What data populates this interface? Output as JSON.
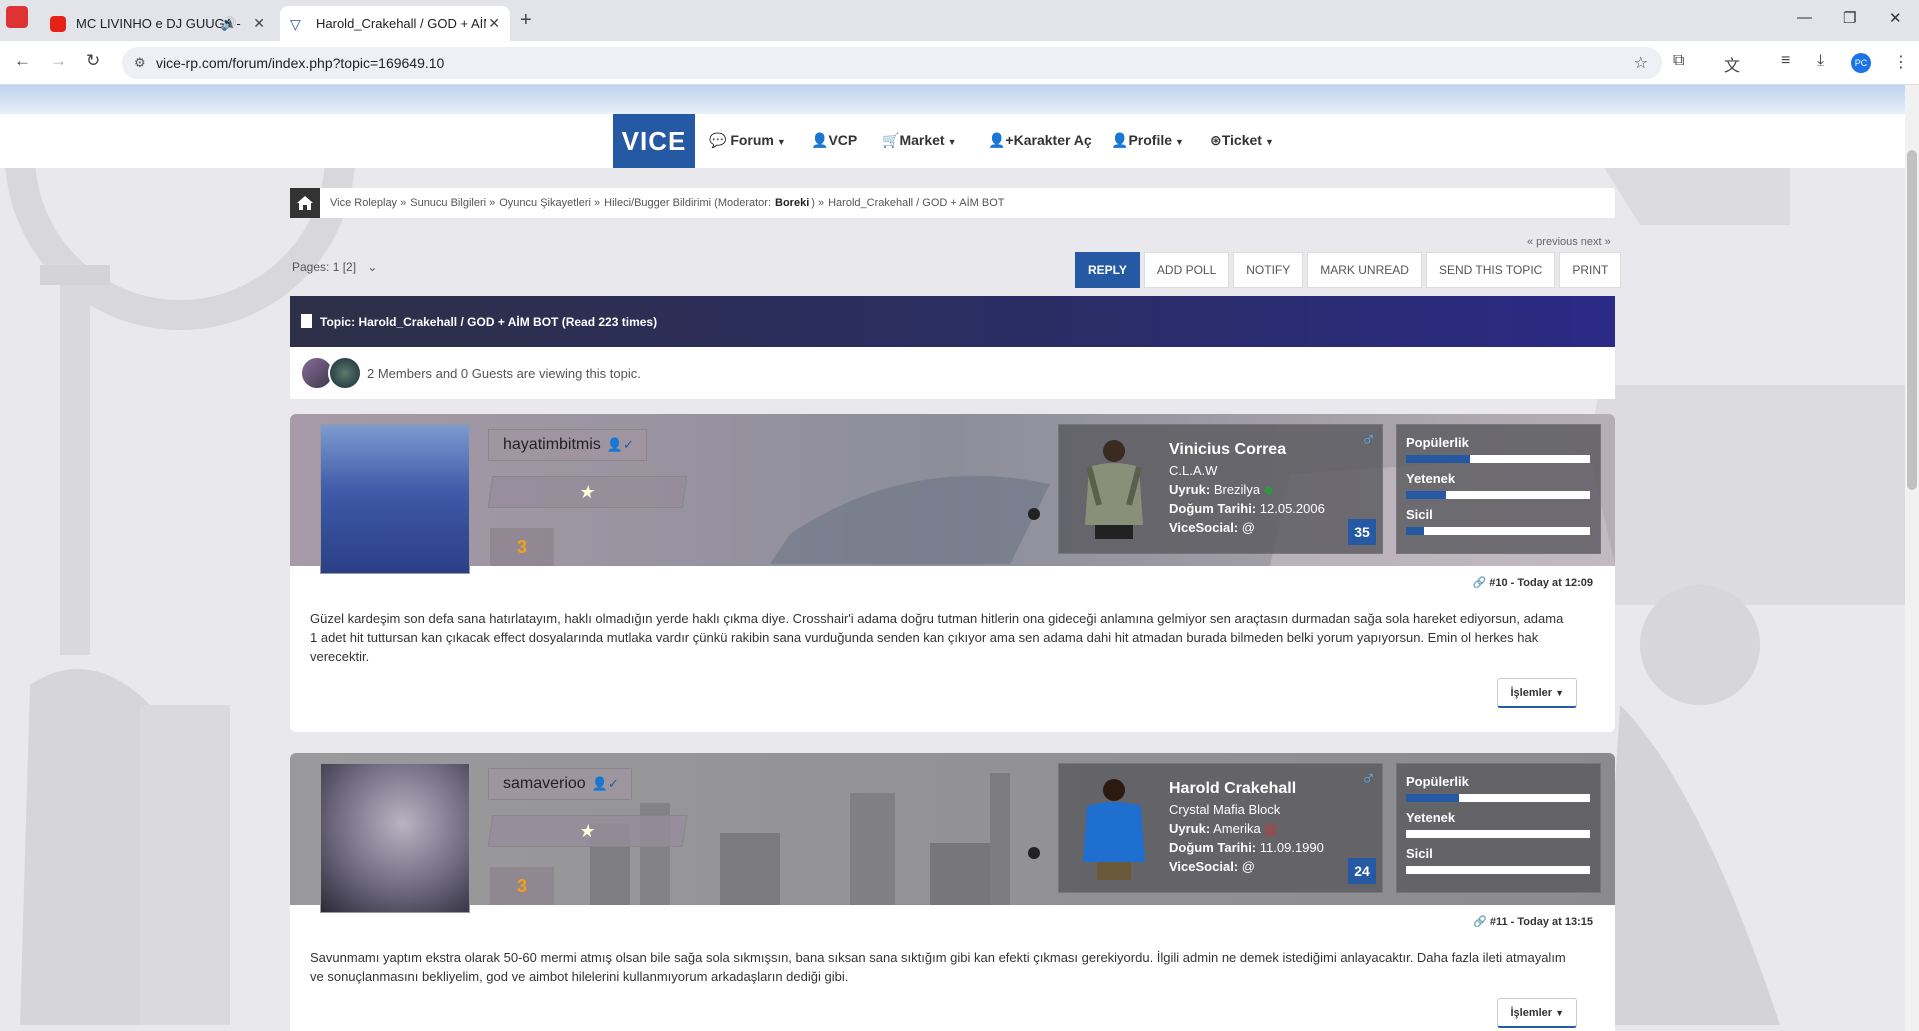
{
  "browser": {
    "tabs": [
      {
        "title": "MC LIVINHO e DJ GUUGA -",
        "active": false
      },
      {
        "title": "Harold_Crakehall / GOD + AİM",
        "active": true
      }
    ],
    "url": "vice-rp.com/forum/index.php?topic=169649.10",
    "profile_initials": "PC"
  },
  "nav": {
    "brand": "VICE",
    "items": [
      {
        "label": "Forum",
        "icon": "comments-icon",
        "dropdown": true
      },
      {
        "label": "VCP",
        "icon": "user-icon",
        "dropdown": false
      },
      {
        "label": "Market",
        "icon": "cart-icon",
        "dropdown": true
      },
      {
        "label": "Karakter Aç",
        "icon": "user-plus-icon",
        "dropdown": false
      },
      {
        "label": "Profile",
        "icon": "user-icon",
        "dropdown": true
      },
      {
        "label": "Ticket",
        "icon": "lifebuoy-icon",
        "dropdown": true
      }
    ]
  },
  "breadcrumb": {
    "items": [
      "Vice Roleplay »",
      "Sunucu Bilgileri »",
      "Oyuncu Şikayetleri »",
      "Hileci/Bugger Bildirimi (Moderator:",
      "Boreki",
      ") »",
      "Harold_Crakehall / GOD + AİM BOT"
    ]
  },
  "pagination": {
    "prevnext": "« previous next »",
    "label": "Pages: 1 [2]"
  },
  "actions": [
    "REPLY",
    "ADD POLL",
    "NOTIFY",
    "MARK UNREAD",
    "SEND THIS TOPIC",
    "PRINT"
  ],
  "topic": {
    "title": "Topic: Harold_Crakehall / GOD + AİM BOT  (Read 223 times)",
    "viewers": "2 Members and 0 Guests are viewing this topic."
  },
  "posts": [
    {
      "username": "hayatimbitmis",
      "rank_badge": "3",
      "character": {
        "name": "Vinicius Correa",
        "faction": "C.L.A.W",
        "nationality_label": "Uyruk:",
        "nationality": "Brezilya",
        "birth_label": "Doğum Tarihi:",
        "birth": "12.05.2006",
        "social_label": "ViceSocial:",
        "social": "@",
        "level": "35"
      },
      "stats": {
        "popularity_label": "Popülerlik",
        "popularity": 0.35,
        "skill_label": "Yetenek",
        "skill": 0.22,
        "record_label": "Sicil",
        "record": 0.1
      },
      "meta": "#10 - Today at 12:09",
      "body": "Güzel kardeşim son defa sana hatırlatayım, haklı olmadığın yerde haklı çıkma diye. Crosshair'i adama doğru tutman hitlerin ona gideceği anlamına gelmiyor sen araçtasın durmadan sağa sola hareket ediyorsun, adama 1 adet hit tuttursan kan çıkacak effect dosyalarında mutlaka vardır çünkü rakibin sana vurduğunda senden kan çıkıyor ama sen adama dahi hit atmadan burada bilmeden belki yorum yapıyorsun. Emin ol herkes hak verecektir.",
      "action_label": "İşlemler"
    },
    {
      "username": "samaverioo",
      "rank_badge": "3",
      "character": {
        "name": "Harold Crakehall",
        "faction": "Crystal Mafia Block",
        "nationality_label": "Uyruk:",
        "nationality": "Amerika",
        "birth_label": "Doğum Tarihi:",
        "birth": "11.09.1990",
        "social_label": "ViceSocial:",
        "social": "@",
        "level": "24"
      },
      "stats": {
        "popularity_label": "Popülerlik",
        "popularity": 0.29,
        "skill_label": "Yetenek",
        "skill": 0.0,
        "record_label": "Sicil",
        "record": 0.0
      },
      "meta": "#11 - Today at 13:15",
      "body": "Savunmamı yaptım ekstra olarak 50-60 mermi atmış olsan bile sağa sola sıkmışsın, bana sıksan sana sıktığım gibi kan efekti çıkması gerekiyordu. İlgili admin ne demek istediğimi anlayacaktır. Daha fazla ileti atmayalım ve sonuçlanmasını bekliyelim, god ve aimbot hilelerini kullanmıyorum arkadaşların dediği gibi.",
      "action_label": "İşlemler"
    }
  ]
}
